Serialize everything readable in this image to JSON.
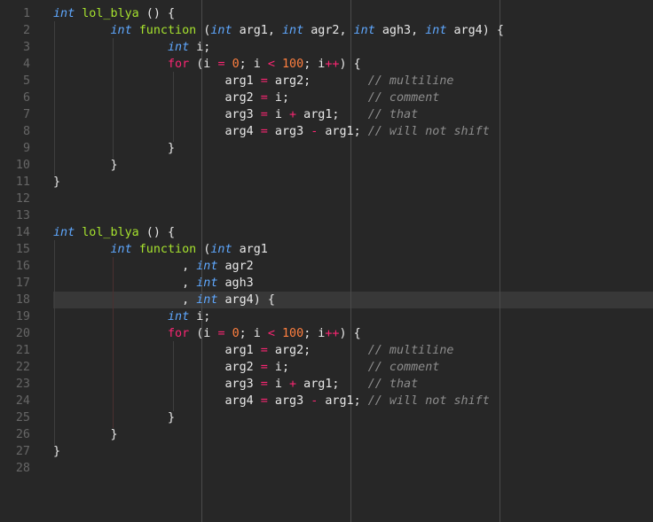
{
  "editor": {
    "lines": [
      {
        "n": "1",
        "t": [
          {
            "c": "kw",
            "s": "int"
          },
          {
            "c": "plain",
            "s": " "
          },
          {
            "c": "fn",
            "s": "lol_blya"
          },
          {
            "c": "plain",
            "s": " () {"
          }
        ]
      },
      {
        "n": "2",
        "t": [
          {
            "c": "plain",
            "s": "        "
          },
          {
            "c": "kw",
            "s": "int"
          },
          {
            "c": "plain",
            "s": " "
          },
          {
            "c": "fn",
            "s": "function"
          },
          {
            "c": "plain",
            "s": " ("
          },
          {
            "c": "kw",
            "s": "int"
          },
          {
            "c": "plain",
            "s": " arg1, "
          },
          {
            "c": "kw",
            "s": "int"
          },
          {
            "c": "plain",
            "s": " agr2, "
          },
          {
            "c": "kw",
            "s": "int"
          },
          {
            "c": "plain",
            "s": " agh3, "
          },
          {
            "c": "kw",
            "s": "int"
          },
          {
            "c": "plain",
            "s": " arg4) {"
          }
        ]
      },
      {
        "n": "3",
        "t": [
          {
            "c": "plain",
            "s": "                "
          },
          {
            "c": "kw",
            "s": "int"
          },
          {
            "c": "plain",
            "s": " i;"
          }
        ]
      },
      {
        "n": "4",
        "t": [
          {
            "c": "plain",
            "s": "                "
          },
          {
            "c": "ctl",
            "s": "for"
          },
          {
            "c": "plain",
            "s": " (i "
          },
          {
            "c": "op",
            "s": "="
          },
          {
            "c": "plain",
            "s": " "
          },
          {
            "c": "num",
            "s": "0"
          },
          {
            "c": "plain",
            "s": "; i "
          },
          {
            "c": "op",
            "s": "<"
          },
          {
            "c": "plain",
            "s": " "
          },
          {
            "c": "num",
            "s": "100"
          },
          {
            "c": "plain",
            "s": "; i"
          },
          {
            "c": "op",
            "s": "++"
          },
          {
            "c": "plain",
            "s": ") {"
          }
        ]
      },
      {
        "n": "5",
        "t": [
          {
            "c": "plain",
            "s": "                        arg1 "
          },
          {
            "c": "op",
            "s": "="
          },
          {
            "c": "plain",
            "s": " arg2;        "
          },
          {
            "c": "cmt",
            "s": "// multiline"
          }
        ]
      },
      {
        "n": "6",
        "t": [
          {
            "c": "plain",
            "s": "                        arg2 "
          },
          {
            "c": "op",
            "s": "="
          },
          {
            "c": "plain",
            "s": " i;           "
          },
          {
            "c": "cmt",
            "s": "// comment"
          }
        ]
      },
      {
        "n": "7",
        "t": [
          {
            "c": "plain",
            "s": "                        arg3 "
          },
          {
            "c": "op",
            "s": "="
          },
          {
            "c": "plain",
            "s": " i "
          },
          {
            "c": "op",
            "s": "+"
          },
          {
            "c": "plain",
            "s": " arg1;    "
          },
          {
            "c": "cmt",
            "s": "// that"
          }
        ]
      },
      {
        "n": "8",
        "t": [
          {
            "c": "plain",
            "s": "                        arg4 "
          },
          {
            "c": "op",
            "s": "="
          },
          {
            "c": "plain",
            "s": " arg3 "
          },
          {
            "c": "op",
            "s": "-"
          },
          {
            "c": "plain",
            "s": " arg1; "
          },
          {
            "c": "cmt",
            "s": "// will not shift"
          }
        ]
      },
      {
        "n": "9",
        "t": [
          {
            "c": "plain",
            "s": "                }"
          }
        ]
      },
      {
        "n": "10",
        "t": [
          {
            "c": "plain",
            "s": "        }"
          }
        ]
      },
      {
        "n": "11",
        "t": [
          {
            "c": "plain",
            "s": "}"
          }
        ]
      },
      {
        "n": "12",
        "t": []
      },
      {
        "n": "13",
        "t": []
      },
      {
        "n": "14",
        "t": [
          {
            "c": "kw",
            "s": "int"
          },
          {
            "c": "plain",
            "s": " "
          },
          {
            "c": "fn",
            "s": "lol_blya"
          },
          {
            "c": "plain",
            "s": " () {"
          }
        ]
      },
      {
        "n": "15",
        "t": [
          {
            "c": "plain",
            "s": "        "
          },
          {
            "c": "kw",
            "s": "int"
          },
          {
            "c": "plain",
            "s": " "
          },
          {
            "c": "fn",
            "s": "function"
          },
          {
            "c": "plain",
            "s": " ("
          },
          {
            "c": "kw",
            "s": "int"
          },
          {
            "c": "plain",
            "s": " arg1"
          }
        ]
      },
      {
        "n": "16",
        "t": [
          {
            "c": "plain",
            "s": "                  , "
          },
          {
            "c": "kw",
            "s": "int"
          },
          {
            "c": "plain",
            "s": " agr2"
          }
        ]
      },
      {
        "n": "17",
        "t": [
          {
            "c": "plain",
            "s": "                  , "
          },
          {
            "c": "kw",
            "s": "int"
          },
          {
            "c": "plain",
            "s": " agh3"
          }
        ]
      },
      {
        "n": "18",
        "t": [
          {
            "c": "plain",
            "s": "                  , "
          },
          {
            "c": "kw",
            "s": "int"
          },
          {
            "c": "plain",
            "s": " arg4) {"
          }
        ]
      },
      {
        "n": "19",
        "t": [
          {
            "c": "plain",
            "s": "                "
          },
          {
            "c": "kw",
            "s": "int"
          },
          {
            "c": "plain",
            "s": " i;"
          }
        ]
      },
      {
        "n": "20",
        "t": [
          {
            "c": "plain",
            "s": "                "
          },
          {
            "c": "ctl",
            "s": "for"
          },
          {
            "c": "plain",
            "s": " (i "
          },
          {
            "c": "op",
            "s": "="
          },
          {
            "c": "plain",
            "s": " "
          },
          {
            "c": "num",
            "s": "0"
          },
          {
            "c": "plain",
            "s": "; i "
          },
          {
            "c": "op",
            "s": "<"
          },
          {
            "c": "plain",
            "s": " "
          },
          {
            "c": "num",
            "s": "100"
          },
          {
            "c": "plain",
            "s": "; i"
          },
          {
            "c": "op",
            "s": "++"
          },
          {
            "c": "plain",
            "s": ") {"
          }
        ]
      },
      {
        "n": "21",
        "t": [
          {
            "c": "plain",
            "s": "                        arg1 "
          },
          {
            "c": "op",
            "s": "="
          },
          {
            "c": "plain",
            "s": " arg2;        "
          },
          {
            "c": "cmt",
            "s": "// multiline"
          }
        ]
      },
      {
        "n": "22",
        "t": [
          {
            "c": "plain",
            "s": "                        arg2 "
          },
          {
            "c": "op",
            "s": "="
          },
          {
            "c": "plain",
            "s": " i;           "
          },
          {
            "c": "cmt",
            "s": "// comment"
          }
        ]
      },
      {
        "n": "23",
        "t": [
          {
            "c": "plain",
            "s": "                        arg3 "
          },
          {
            "c": "op",
            "s": "="
          },
          {
            "c": "plain",
            "s": " i "
          },
          {
            "c": "op",
            "s": "+"
          },
          {
            "c": "plain",
            "s": " arg1;    "
          },
          {
            "c": "cmt",
            "s": "// that"
          }
        ]
      },
      {
        "n": "24",
        "t": [
          {
            "c": "plain",
            "s": "                        arg4 "
          },
          {
            "c": "op",
            "s": "="
          },
          {
            "c": "plain",
            "s": " arg3 "
          },
          {
            "c": "op",
            "s": "-"
          },
          {
            "c": "plain",
            "s": " arg1; "
          },
          {
            "c": "cmt",
            "s": "// will not shift"
          }
        ]
      },
      {
        "n": "25",
        "t": [
          {
            "c": "plain",
            "s": "                }"
          }
        ]
      },
      {
        "n": "26",
        "t": [
          {
            "c": "plain",
            "s": "        }"
          }
        ]
      },
      {
        "n": "27",
        "t": [
          {
            "c": "plain",
            "s": "}"
          }
        ]
      },
      {
        "n": "28",
        "t": []
      }
    ]
  },
  "colors": {
    "background": "#272727",
    "keyword": "#5fa8ff",
    "function": "#a6e22e",
    "control": "#f92672",
    "number": "#ff7f3f",
    "comment": "#8d8d8d",
    "text": "#e8e8e8",
    "gutter": "#666666",
    "active_line": "#383838"
  },
  "active_line": "18"
}
